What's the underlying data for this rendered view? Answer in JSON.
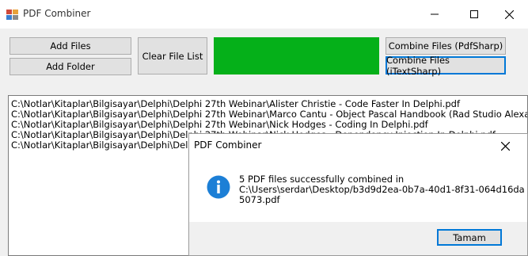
{
  "window": {
    "title": "PDF Combiner",
    "icon": "pdf-app-icon",
    "controls": [
      "minimize-icon",
      "maximize-icon",
      "close-icon"
    ]
  },
  "toolbar": {
    "add_files": "Add Files",
    "add_folder": "Add Folder",
    "clear_file_list": "Clear File List",
    "combine_pdfsharp": "Combine Files (PdfSharp)",
    "combine_itextsharp": "Combine Files (iTextSharp)",
    "status_color": "#05b019"
  },
  "file_list": {
    "items": [
      "C:\\Notlar\\Kitaplar\\Bilgisayar\\Delphi\\Delphi 27th Webinar\\Alister Christie - Code Faster In Delphi.pdf",
      "C:\\Notlar\\Kitaplar\\Bilgisayar\\Delphi\\Delphi 27th Webinar\\Marco Cantu - Object Pascal Handbook (Rad Studio Alexandria Version).pdf",
      "C:\\Notlar\\Kitaplar\\Bilgisayar\\Delphi\\Delphi 27th Webinar\\Nick Hodges - Coding In Delphi.pdf",
      "C:\\Notlar\\Kitaplar\\Bilgisayar\\Delphi\\Delphi 27th Webinar\\Nick Hodges - Dependency Injection In Delphi.pdf",
      "C:\\Notlar\\Kitaplar\\Bilgisayar\\Delphi\\Delphi 27th Webinar\\"
    ]
  },
  "dialog": {
    "title": "PDF Combiner",
    "icon": "info-icon",
    "message_lines": [
      "5 PDF files successfully combined in",
      "C:\\Users\\serdar\\Desktop/b3d9d2ea-0b7a-40d1-8f31-064d16da",
      "5073.pdf"
    ],
    "ok_label": "Tamam"
  }
}
